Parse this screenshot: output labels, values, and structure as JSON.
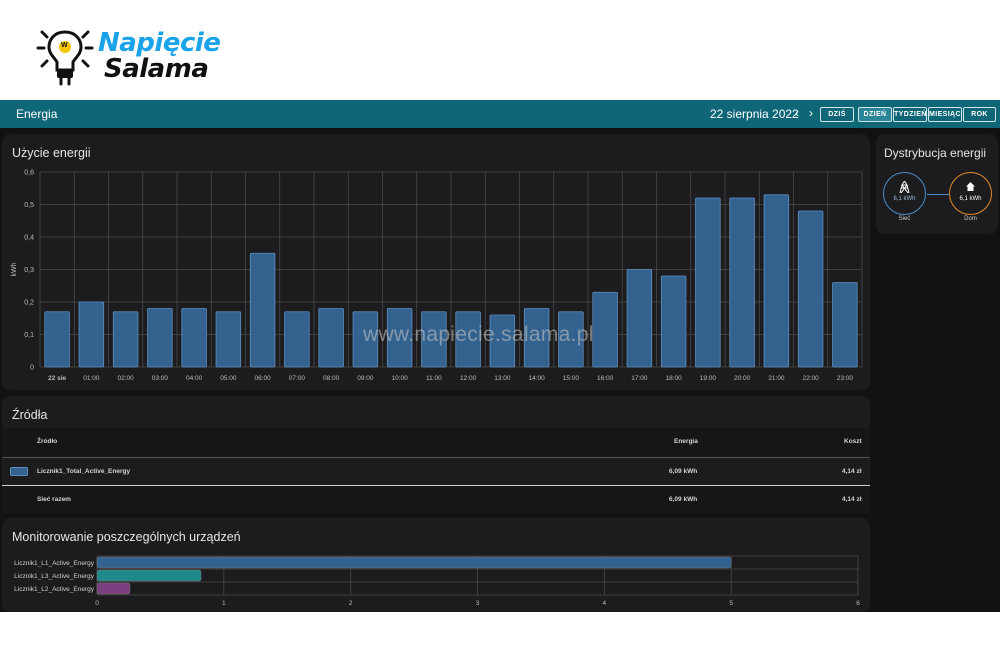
{
  "logo": {
    "line1": "Napięcie",
    "line2": "Salama",
    "bulb_letter": "W",
    "colors": {
      "blue": "#1aa3e8",
      "dark": "#111111"
    }
  },
  "topbar": {
    "title": "Energia",
    "date": "22 sierpnia 2022",
    "prev_icon": "chevron-left-icon",
    "next_icon": "chevron-right-icon",
    "today_label": "DZIŚ",
    "periods": [
      "DZIEŃ",
      "TYDZIEŃ",
      "MIESIĄC",
      "ROK"
    ],
    "active_period": "DZIEŃ",
    "accent": "#0f6677"
  },
  "usage": {
    "title": "Użycie energii"
  },
  "chart_data": {
    "type": "bar",
    "title": "Użycie energii",
    "ylabel": "kWh",
    "xlabel": "",
    "ylim": [
      0,
      0.6
    ],
    "yticks": [
      "0",
      "0,1",
      "0,2",
      "0,3",
      "0,4",
      "0,5",
      "0,6"
    ],
    "categories": [
      "22 sie",
      "01:00",
      "02:00",
      "03:00",
      "04:00",
      "05:00",
      "06:00",
      "07:00",
      "08:00",
      "09:00",
      "10:00",
      "11:00",
      "12:00",
      "13:00",
      "14:00",
      "15:00",
      "16:00",
      "17:00",
      "18:00",
      "19:00",
      "20:00",
      "21:00",
      "22:00",
      "23:00"
    ],
    "values": [
      0.17,
      0.2,
      0.17,
      0.18,
      0.18,
      0.17,
      0.35,
      0.17,
      0.18,
      0.17,
      0.18,
      0.17,
      0.17,
      0.16,
      0.18,
      0.17,
      0.23,
      0.3,
      0.28,
      0.52,
      0.52,
      0.53,
      0.48,
      0.26
    ],
    "grid": true,
    "bar_color": "#33628f"
  },
  "distribution": {
    "title": "Dystrybucja energii",
    "grid": {
      "icon": "transmission-tower-icon",
      "value": "6,1 kWh",
      "label": "Sieć"
    },
    "home": {
      "icon": "home-icon",
      "value": "6,1 kWh",
      "label": "Dom"
    }
  },
  "sources": {
    "title": "Źródła",
    "headers": {
      "source": "Źródło",
      "energy": "Energia",
      "cost": "Koszt"
    },
    "rows": [
      {
        "name": "Licznik1_Total_Active_Energy",
        "energy": "6,09 kWh",
        "cost": "4,14 zł"
      }
    ],
    "total": {
      "label": "Sieć razem",
      "energy": "6,09 kWh",
      "cost": "4,14 zł"
    }
  },
  "devices": {
    "title": "Monitorowanie poszczególnych urządzeń"
  },
  "devices_chart": {
    "type": "bar",
    "orientation": "horizontal",
    "categories": [
      "Licznik1_L1_Active_Energy",
      "Licznik1_L3_Active_Energy",
      "Licznik1_L2_Active_Energy"
    ],
    "values": [
      5.0,
      0.82,
      0.26
    ],
    "colors": [
      "#33628f",
      "#1f8a8a",
      "#7b3f7f"
    ],
    "xlim": [
      0,
      6
    ],
    "xticks": [
      "0",
      "1",
      "2",
      "3",
      "4",
      "5",
      "6"
    ]
  },
  "watermark": "www.napiecie.salama.pl"
}
